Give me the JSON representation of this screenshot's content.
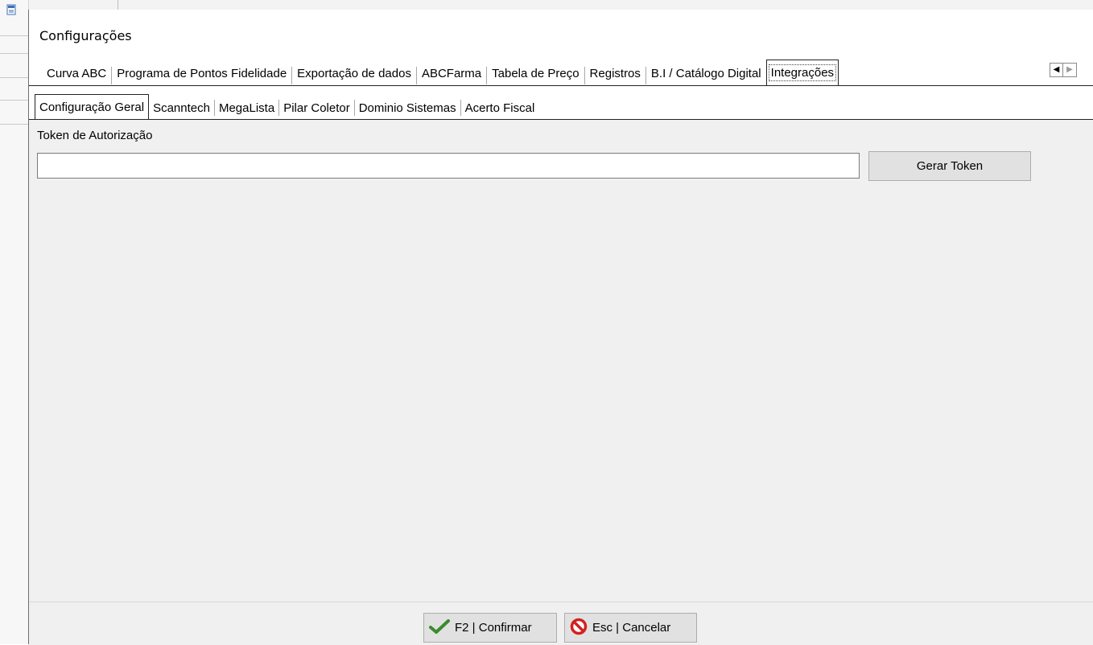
{
  "dialog": {
    "title": "Configurações"
  },
  "top_tabs": [
    {
      "label": "Curva ABC",
      "active": false
    },
    {
      "label": "Programa de Pontos Fidelidade",
      "active": false
    },
    {
      "label": "Exportação de dados",
      "active": false
    },
    {
      "label": "ABCFarma",
      "active": false
    },
    {
      "label": "Tabela de Preço",
      "active": false
    },
    {
      "label": "Registros",
      "active": false
    },
    {
      "label": "B.I / Catálogo Digital",
      "active": false
    },
    {
      "label": "Integrações",
      "active": true
    }
  ],
  "tab_scroll": {
    "left_icon": "triangle-left-icon",
    "right_icon": "triangle-right-icon"
  },
  "sub_tabs": [
    {
      "label": "Configuração Geral",
      "active": true
    },
    {
      "label": "Scanntech",
      "active": false
    },
    {
      "label": "MegaLista",
      "active": false
    },
    {
      "label": "Pilar Coletor",
      "active": false
    },
    {
      "label": "Dominio Sistemas",
      "active": false
    },
    {
      "label": "Acerto Fiscal",
      "active": false
    }
  ],
  "token": {
    "label": "Token de Autorização",
    "value": "",
    "placeholder": "",
    "button_label": "Gerar Token"
  },
  "footer": {
    "confirm_label": "F2 | Confirmar",
    "confirm_icon": "checkmark-icon",
    "cancel_label": "Esc | Cancelar",
    "cancel_icon": "no-entry-icon"
  },
  "colors": {
    "panel_bg": "#f0f0f0",
    "button_bg": "#e1e1e1",
    "confirm_icon": "#3a8a2e",
    "cancel_icon": "#d42020"
  }
}
